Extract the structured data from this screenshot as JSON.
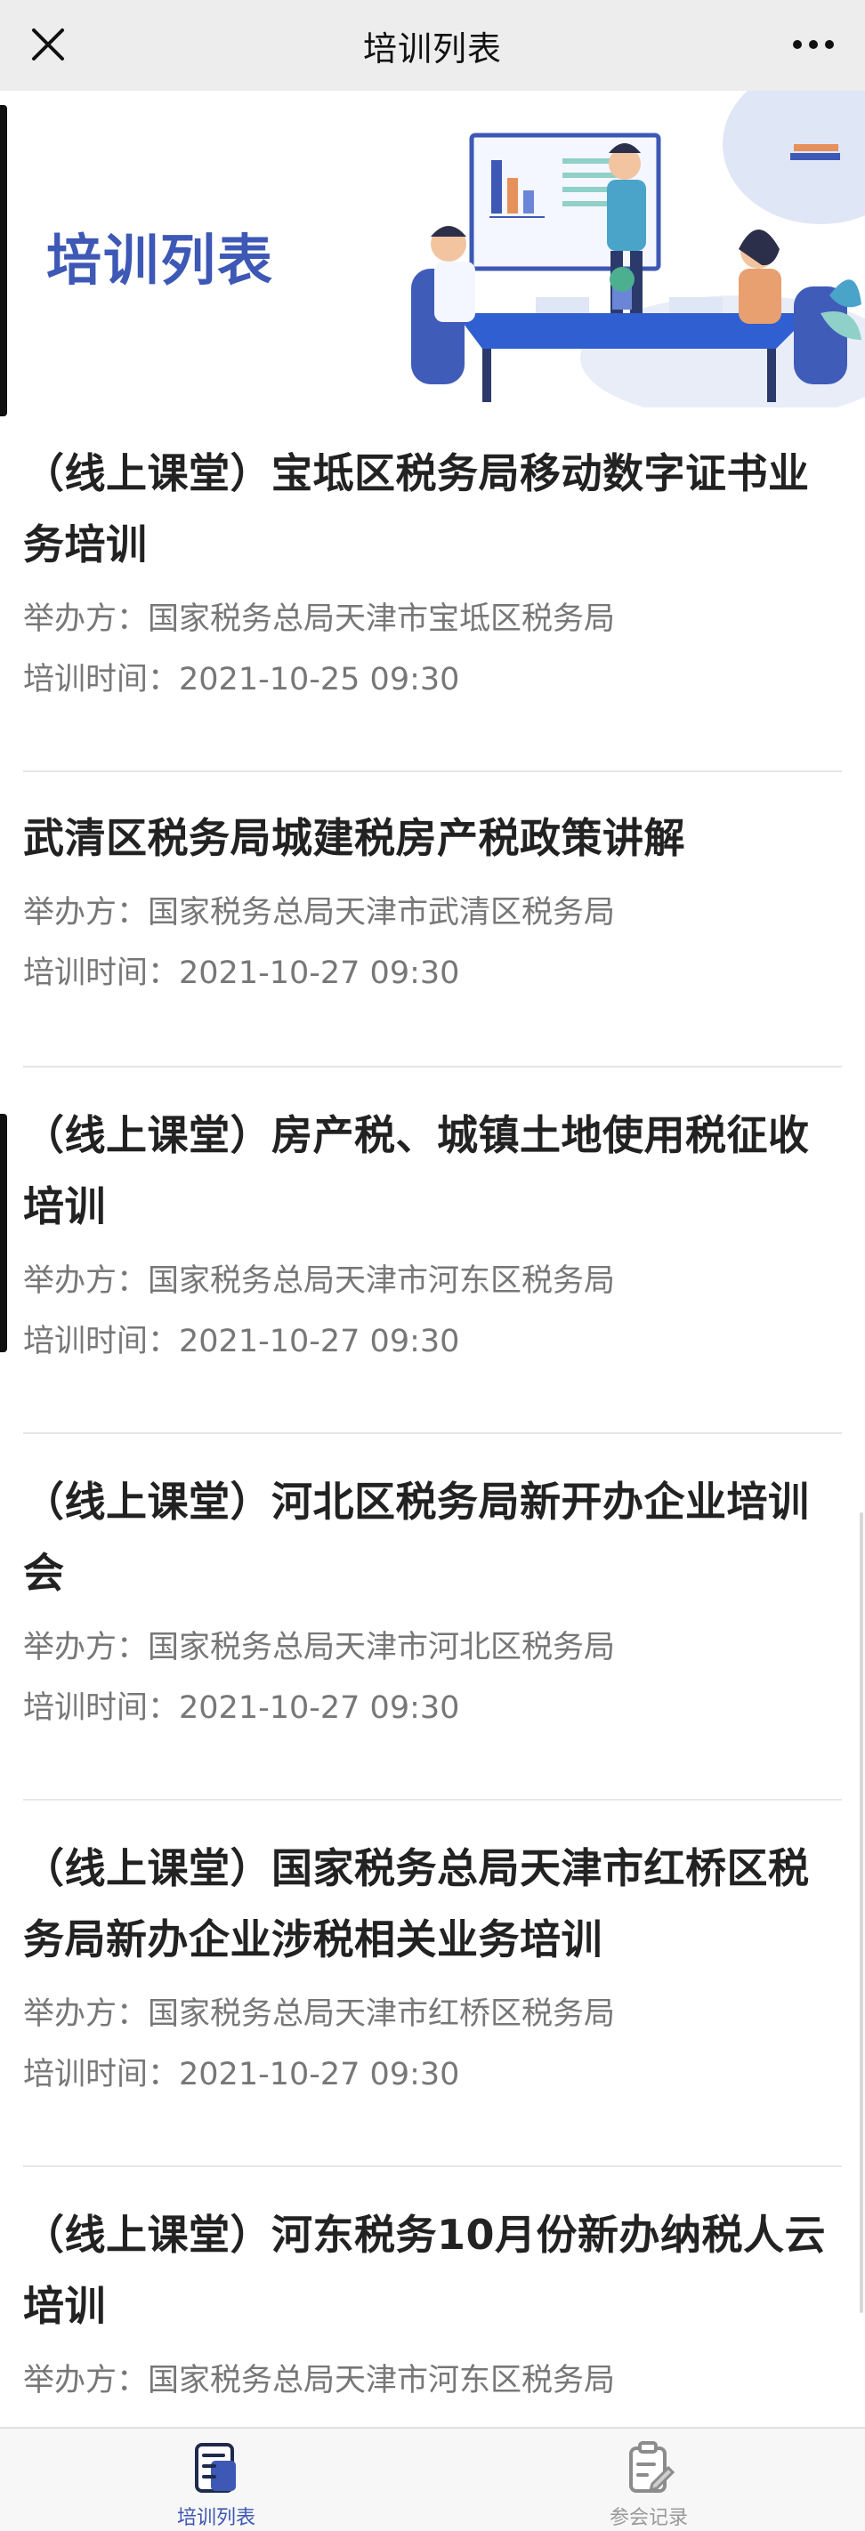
{
  "navbar": {
    "title": "培训列表",
    "close_icon": "close-icon",
    "more_icon": "more-dots-icon"
  },
  "banner": {
    "title": "培训列表",
    "illustration": "meeting-illustration",
    "accent": "#3d58b5"
  },
  "trainings": [
    {
      "title_line1": "（线上课堂）宝坻区税务局移动数字证书业",
      "title_line2": "务培训",
      "organizer_label": "举办方：",
      "organizer": "国家税务总局天津市宝坻区税务局",
      "time_label": "培训时间：",
      "time": "2021-10-25 09:30"
    },
    {
      "title_line1": "武清区税务局城建税房产税政策讲解",
      "title_line2": "",
      "organizer_label": "举办方：",
      "organizer": "国家税务总局天津市武清区税务局",
      "time_label": "培训时间：",
      "time": "2021-10-27 09:30"
    },
    {
      "title_line1": "（线上课堂）房产税、城镇土地使用税征收",
      "title_line2": "培训",
      "organizer_label": "举办方：",
      "organizer": "国家税务总局天津市河东区税务局",
      "time_label": "培训时间：",
      "time": "2021-10-27 09:30"
    },
    {
      "title_line1": "（线上课堂）河北区税务局新开办企业培训",
      "title_line2": "会",
      "organizer_label": "举办方：",
      "organizer": "国家税务总局天津市河北区税务局",
      "time_label": "培训时间：",
      "time": "2021-10-27 09:30"
    },
    {
      "title_line1": "（线上课堂）国家税务总局天津市红桥区税",
      "title_line2": "务局新办企业涉税相关业务培训",
      "organizer_label": "举办方：",
      "organizer": "国家税务总局天津市红桥区税务局",
      "time_label": "培训时间：",
      "time": "2021-10-27 09:30"
    },
    {
      "title_line1": "（线上课堂）河东税务10月份新办纳税人云",
      "title_line2": "培训",
      "organizer_label": "举办方：",
      "organizer": "国家税务总局天津市河东区税务局",
      "time_label": "",
      "time": ""
    }
  ],
  "tabbar": {
    "tabs": [
      {
        "label": "培训列表",
        "icon": "training-list-icon",
        "active": true
      },
      {
        "label": "参会记录",
        "icon": "attendance-record-icon",
        "active": false
      }
    ],
    "active_color": "#3d58b5",
    "inactive_color": "#999999"
  }
}
